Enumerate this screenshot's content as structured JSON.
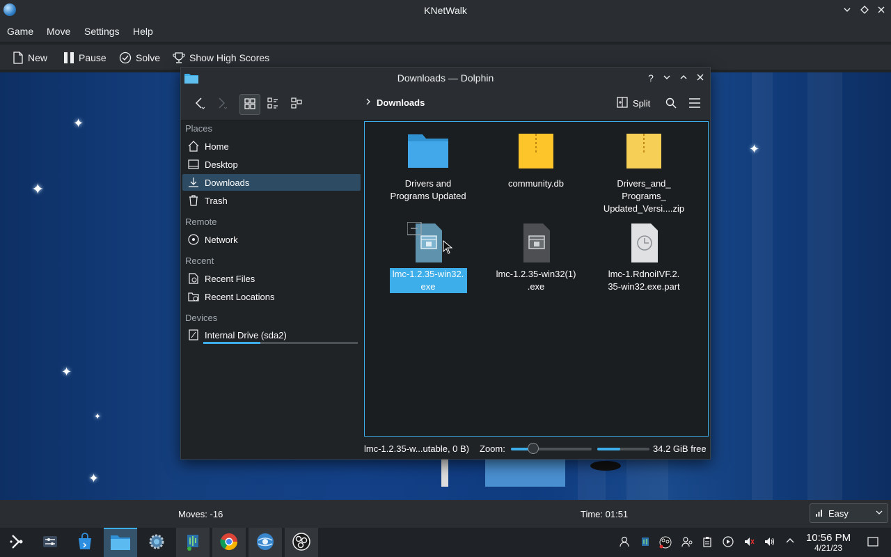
{
  "knetwalk": {
    "title": "KNetWalk",
    "menu": [
      "Game",
      "Move",
      "Settings",
      "Help"
    ],
    "toolbar": {
      "new": "New",
      "pause": "Pause",
      "solve": "Solve",
      "high_scores": "Show High Scores"
    },
    "status": {
      "moves": "Moves: -16",
      "time": "Time: 01:51",
      "difficulty": "Easy"
    }
  },
  "dolphin": {
    "title": "Downloads — Dolphin",
    "breadcrumb": "Downloads",
    "split_label": "Split",
    "places_header": "Places",
    "places": [
      "Home",
      "Desktop",
      "Downloads",
      "Trash"
    ],
    "remote_header": "Remote",
    "remote": [
      "Network"
    ],
    "recent_header": "Recent",
    "recent": [
      "Recent Files",
      "Recent Locations"
    ],
    "devices_header": "Devices",
    "devices": [
      "Internal Drive (sda2)"
    ],
    "drive_usage_fraction": 0.37,
    "files": [
      {
        "line1": "Drivers and",
        "line2": "Programs Updated",
        "line3": "",
        "icon": "folder-icon"
      },
      {
        "line1": "community.db",
        "line2": "",
        "line3": "",
        "icon": "archive-icon"
      },
      {
        "line1": "Drivers_and_",
        "line2": "Programs_",
        "line3": "Updated_Versi....zip",
        "icon": "archive-icon"
      },
      {
        "line1": "lmc-1.2.35-win32.",
        "line2": "exe",
        "line3": "",
        "icon": "executable-icon"
      },
      {
        "line1": "lmc-1.2.35-win32(1)",
        "line2": ".exe",
        "line3": "",
        "icon": "executable-icon"
      },
      {
        "line1": "lmc-1.RdnoiIVF.2.",
        "line2": "35-win32.exe.part",
        "line3": "",
        "icon": "partial-download-icon"
      }
    ],
    "status_text": "lmc-1.2.35-w...utable, 0 B)",
    "zoom_label": "Zoom:",
    "zoom_fraction": 0.28,
    "space_used_fraction": 0.44,
    "free_space": "34.2 GiB free"
  },
  "taskbar": {
    "clock_time": "10:56 PM",
    "clock_date": "4/21/23"
  },
  "colors": {
    "accent": "#3daee9",
    "window_bg": "#202326",
    "titlebar": "#2a2e32",
    "desktop_blue": "#134087"
  }
}
